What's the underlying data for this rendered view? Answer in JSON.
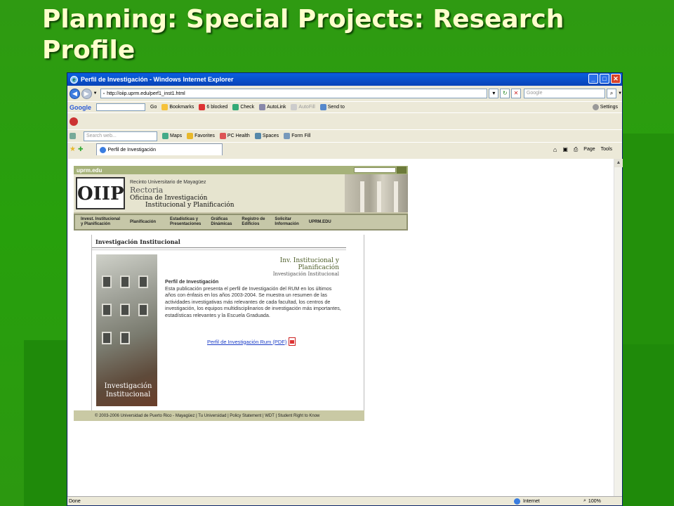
{
  "slide": {
    "title": "Planning: Special Projects: Research Profile"
  },
  "window": {
    "title": "Perfil de Investigación - Windows Internet Explorer"
  },
  "address": {
    "url": "http://oiip.uprm.edu/perf1_inst1.html",
    "search_placeholder": "Google"
  },
  "toolbar_google": {
    "logo": "Google",
    "go_label": "Go",
    "bookmarks": "Bookmarks",
    "blocked": "6 blocked",
    "check": "Check",
    "autolink": "AutoLink",
    "autofill": "AutoFill",
    "send_to": "Send to",
    "settings": "Settings"
  },
  "toolbar_links": {
    "search_placeholder": "Search web...",
    "maps": "Maps",
    "favorites": "Favorites",
    "pc_health": "PC Health",
    "spaces": "Spaces",
    "form_fill": "Form Fill"
  },
  "tab": {
    "label": "Perfil de Investigación"
  },
  "command_bar": {
    "page": "Page",
    "tools": "Tools"
  },
  "site": {
    "brand": "uprm.edu",
    "logo_text": "OIIP",
    "recinto": "Recinto Universitario de Mayagüez",
    "rectoria": "Rectoria",
    "oficina_1": "Oficina de Investigación",
    "oficina_2": "Institucional y Planificación",
    "menu": [
      {
        "l1": "Invest. Institucional",
        "l2": "y Planificación"
      },
      {
        "l1": "Planificación",
        "l2": ""
      },
      {
        "l1": "Estadísticas y",
        "l2": "Presentaciones"
      },
      {
        "l1": "Gráficas",
        "l2": "Dinámicas"
      },
      {
        "l1": "Registro de",
        "l2": "Edificios"
      },
      {
        "l1": "Solicitar",
        "l2": "Información"
      },
      {
        "l1": "UPRM.EDU",
        "l2": ""
      }
    ],
    "section_heading": "Investigación Institucional",
    "iip_title": "Inv. Institucional y Planificación",
    "iip_sub": "Investigación Institucional",
    "photo_caption_1": "Investigación",
    "photo_caption_2": "Institucional",
    "desc_title": "Perfil de Investigación",
    "desc_body": "Esta publicación presenta el perfil de Investigación del RUM en los últimos años con énfasis en los años 2003-2004. Se muestra un resumen de las actividades investigativas más relevantes de cada facultad, los centros de investigación, los equipos multidisciplinarios de investigación más importantes, estadísticas relevantes y la Escuela Graduada.",
    "pdf_link": "Perfil de Investigación Rum (PDF)",
    "footer": "© 2003-2006 Universidad de Puerto Rico - Mayagüez | Tu Universidad | Policy Statement | WDT | Student Right to Know"
  },
  "status": {
    "left": "Done",
    "zone": "Internet",
    "zoom": "100%"
  }
}
